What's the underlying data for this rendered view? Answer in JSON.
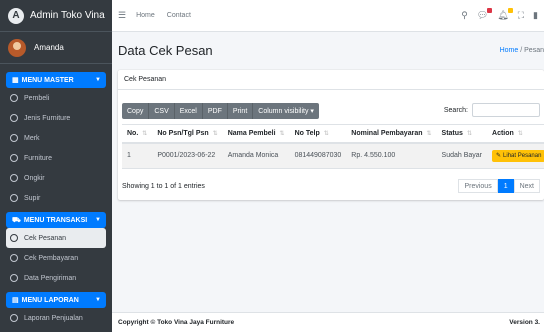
{
  "brand": {
    "name": "Admin Toko Vina",
    "logo_letter": "A"
  },
  "user": {
    "name": "Amanda"
  },
  "sidebar": {
    "sections": [
      {
        "title": "MENU MASTER",
        "items": [
          "Pembeli",
          "Jenis Furniture",
          "Merk",
          "Furniture",
          "Ongkir",
          "Supir"
        ]
      },
      {
        "title": "MENU TRANSAKSI",
        "items": [
          "Cek Pesanan",
          "Cek Pembayaran",
          "Data Pengiriman"
        ],
        "active_index": 0
      },
      {
        "title": "MENU LAPORAN",
        "items": [
          "Laporan Penjualan"
        ]
      }
    ]
  },
  "topnav": {
    "home": "Home",
    "contact": "Contact"
  },
  "page": {
    "title": "Data Cek Pesan",
    "breadcrumb_home": "Home",
    "breadcrumb_sep": " / ",
    "breadcrumb_current": "Pesan"
  },
  "card": {
    "title": "Cek Pesanan"
  },
  "toolbar": {
    "buttons": [
      "Copy",
      "CSV",
      "Excel",
      "PDF",
      "Print",
      "Column visibility ▾"
    ]
  },
  "search": {
    "label": "Search:",
    "value": ""
  },
  "table": {
    "columns": [
      "No.",
      "No Psn/Tgl Psn",
      "Nama Pembeli",
      "No Telp",
      "Nominal Pembayaran",
      "Status",
      "Action"
    ],
    "rows": [
      {
        "no": "1",
        "psn": "P0001/2023-06-22",
        "nama": "Amanda Monica",
        "telp": "081449087030",
        "nominal": "Rp. 4.550.100",
        "status": "Sudah Bayar",
        "action": "Lihat Pesanan"
      }
    ]
  },
  "table_info": "Showing 1 to 1 of 1 entries",
  "pager": {
    "previous": "Previous",
    "current": "1",
    "next": "Next"
  },
  "footer": {
    "copyright": "Copyright © Toko Vina Jaya Furniture",
    "version": "Version 3."
  },
  "colors": {
    "primary": "#007bff",
    "sidebar": "#343a40",
    "warning": "#ffc107"
  }
}
